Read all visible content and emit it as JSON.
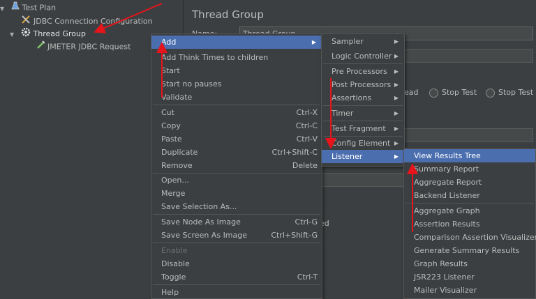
{
  "tree": {
    "items": [
      {
        "label": "Test Plan"
      },
      {
        "label": "JDBC Connection Configuration"
      },
      {
        "label": "Thread Group"
      },
      {
        "label": "JMETER JDBC Request"
      }
    ]
  },
  "panel": {
    "title": "Thread Group",
    "name_label": "Name:",
    "name_value": "Thread Group",
    "radio_1": "ead",
    "radio_2": "Stop Test",
    "radio_3": "Stop Test N",
    "partial_text": "ded"
  },
  "context_menu": {
    "add": "Add",
    "add_think_times": "Add Think Times to children",
    "start": "Start",
    "start_no_pauses": "Start no pauses",
    "validate": "Validate",
    "cut": "Cut",
    "cut_sc": "Ctrl-X",
    "copy": "Copy",
    "copy_sc": "Ctrl-C",
    "paste": "Paste",
    "paste_sc": "Ctrl-V",
    "duplicate": "Duplicate",
    "duplicate_sc": "Ctrl+Shift-C",
    "remove": "Remove",
    "remove_sc": "Delete",
    "open": "Open...",
    "merge": "Merge",
    "save_selection": "Save Selection As...",
    "save_node_image": "Save Node As Image",
    "save_node_image_sc": "Ctrl-G",
    "save_screen_image": "Save Screen As Image",
    "save_screen_image_sc": "Ctrl+Shift-G",
    "enable": "Enable",
    "disable": "Disable",
    "toggle": "Toggle",
    "toggle_sc": "Ctrl-T",
    "help": "Help"
  },
  "add_menu": {
    "items": [
      "Sampler",
      "Logic Controller",
      "Pre Processors",
      "Post Processors",
      "Assertions",
      "Timer",
      "Test Fragment",
      "Config Element",
      "Listener"
    ]
  },
  "listener_menu": {
    "items": [
      "View Results Tree",
      "Summary Report",
      "Aggregate Report",
      "Backend Listener",
      "Aggregate Graph",
      "Assertion Results",
      "Comparison Assertion Visualizer",
      "Generate Summary Results",
      "Graph Results",
      "JSR223 Listener",
      "Mailer Visualizer"
    ]
  },
  "colors": {
    "highlight": "#4b6eaf",
    "annotation_arrow": "#e8141b",
    "background": "#3c3f41"
  }
}
